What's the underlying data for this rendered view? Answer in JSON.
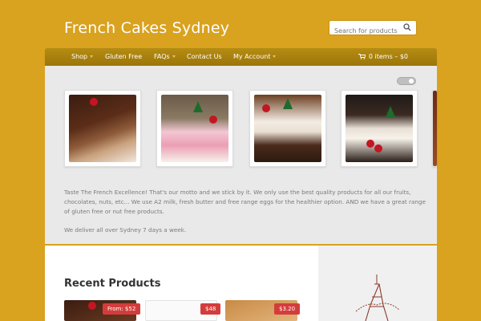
{
  "site": {
    "title": "French Cakes Sydney"
  },
  "search": {
    "placeholder": "Search for products"
  },
  "nav": {
    "items": [
      "Shop",
      "Gluten Free",
      "FAQs",
      "Contact Us",
      "My Account"
    ],
    "cart_label": "0 items – $0"
  },
  "intro": {
    "text": "Taste The French Excellence! That's our motto and we stick by it. We only use the best quality products for all our fruits, chocolates, nuts, etc... We use A2 milk, fresh butter and free range eggs for the healthier option. AND we have a great range of gluten free or nut free products.",
    "deliver": "We deliver all over Sydney 7 days a week."
  },
  "recent": {
    "title": "Recent Products",
    "prices": [
      "From: $52",
      "$48",
      "$3.20"
    ]
  },
  "colors": {
    "background": "#d9a21f",
    "nav": "#a8800d",
    "price_tag": "#d43c3c"
  },
  "icons": [
    "search-icon",
    "cart-icon",
    "caret-down-icon",
    "toggle-switch"
  ]
}
